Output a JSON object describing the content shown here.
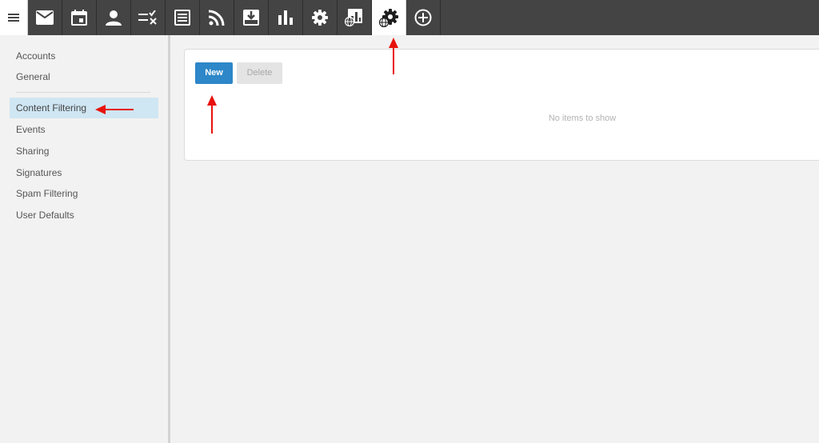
{
  "toolbar": {
    "menu_icon": "hamburger-menu-icon",
    "items": [
      {
        "icon": "mail-icon"
      },
      {
        "icon": "calendar-icon"
      },
      {
        "icon": "contacts-icon"
      },
      {
        "icon": "tasks-icon"
      },
      {
        "icon": "notes-icon"
      },
      {
        "icon": "rss-icon"
      },
      {
        "icon": "file-download-icon"
      },
      {
        "icon": "reports-icon"
      },
      {
        "icon": "settings-icon"
      },
      {
        "icon": "domain-reports-icon"
      },
      {
        "icon": "domain-settings-icon",
        "active": true
      },
      {
        "icon": "add-icon"
      }
    ]
  },
  "sidebar": {
    "items": [
      {
        "label": "Accounts"
      },
      {
        "label": "General"
      },
      {
        "label": "Content Filtering",
        "active": true
      },
      {
        "label": "Events"
      },
      {
        "label": "Sharing"
      },
      {
        "label": "Signatures"
      },
      {
        "label": "Spam Filtering"
      },
      {
        "label": "User Defaults"
      }
    ]
  },
  "content": {
    "new_label": "New",
    "delete_label": "Delete",
    "empty_message": "No items to show"
  },
  "colors": {
    "toolbar_bg": "#444444",
    "accent": "#2d87c8",
    "active_item_bg": "#cfe6f3",
    "annotation_arrow": "#e8120c"
  }
}
